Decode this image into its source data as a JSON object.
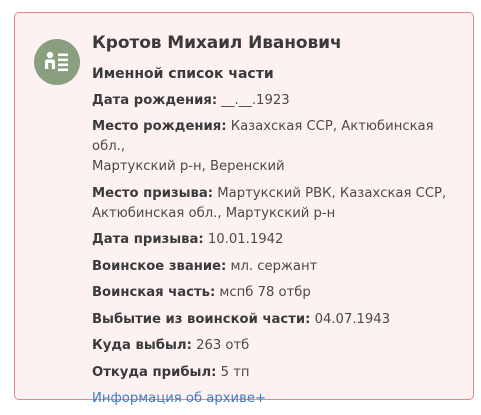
{
  "person": {
    "name": "Кротов Михаил Иванович",
    "source": "Именной список части"
  },
  "fields": {
    "birth_date": {
      "label": "Дата рождения:",
      "value": "__.__.1923"
    },
    "birth_place": {
      "label": "Место рождения:",
      "value_line1": "Казахская ССР, Актюбинская обл.,",
      "value_line2": "Мартукский р-н, Веренский"
    },
    "conscription_place": {
      "label": "Место призыва:",
      "value_line1": "Мартукский РВК, Казахская ССР,",
      "value_line2": "Актюбинская обл., Мартукский р-н"
    },
    "conscription_date": {
      "label": "Дата призыва:",
      "value": "10.01.1942"
    },
    "rank": {
      "label": "Воинское звание:",
      "value": "мл. сержант"
    },
    "unit": {
      "label": "Воинская часть:",
      "value": "мспб 78 отбр"
    },
    "departure_date": {
      "label": "Выбытие из воинской части:",
      "value": "04.07.1943"
    },
    "departed_to": {
      "label": "Куда выбыл:",
      "value": "263 отб"
    },
    "arrived_from": {
      "label": "Откуда прибыл:",
      "value": "5 тп"
    }
  },
  "archive_link": "Информация об архиве+",
  "icon": "person-list-icon",
  "colors": {
    "card_background": "#fdf1f1",
    "card_border": "#e08a8c",
    "avatar_background": "#8a9f7f",
    "link": "#3d7cc9"
  }
}
